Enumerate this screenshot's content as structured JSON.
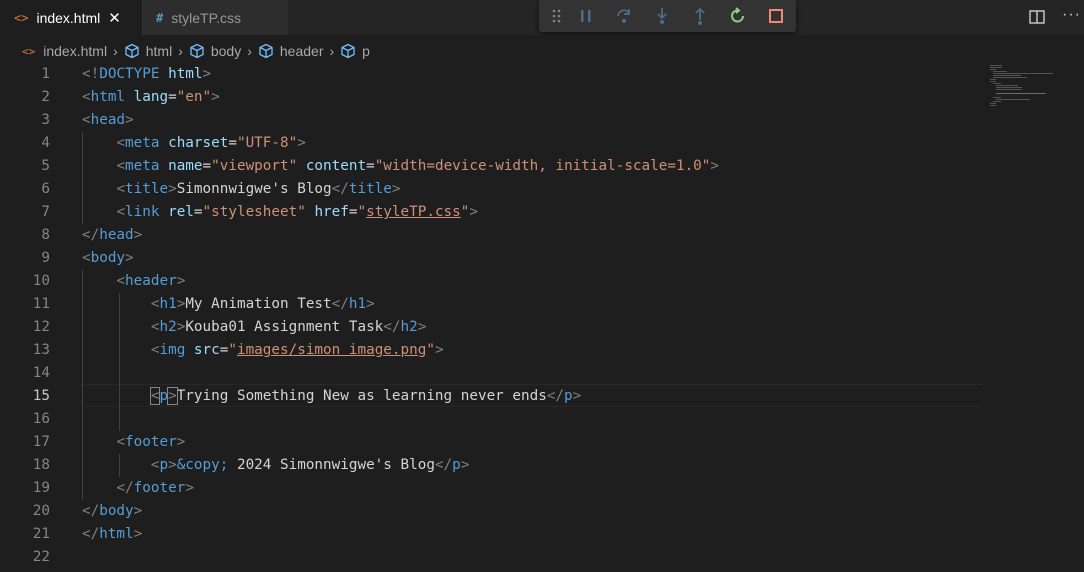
{
  "tabs": [
    {
      "label": "index.html",
      "icon": "html-file-icon",
      "active": true
    },
    {
      "label": "styleTP.css",
      "icon": "css-file-icon",
      "active": false
    }
  ],
  "debug_toolbar": {
    "buttons": [
      "drag-handle",
      "pause",
      "step-over",
      "step-into",
      "step-out",
      "restart",
      "stop"
    ],
    "colors": {
      "restart": "#89d185",
      "stop": "#f48771",
      "default": "#75beff"
    }
  },
  "breadcrumb": [
    "index.html",
    "html",
    "body",
    "header",
    "p"
  ],
  "editor": {
    "lines": [
      {
        "n": "1"
      },
      {
        "n": "2"
      },
      {
        "n": "3"
      },
      {
        "n": "4"
      },
      {
        "n": "5"
      },
      {
        "n": "6"
      },
      {
        "n": "7"
      },
      {
        "n": "8"
      },
      {
        "n": "9"
      },
      {
        "n": "10"
      },
      {
        "n": "11"
      },
      {
        "n": "12"
      },
      {
        "n": "13"
      },
      {
        "n": "14"
      },
      {
        "n": "15"
      },
      {
        "n": "16"
      },
      {
        "n": "17"
      },
      {
        "n": "18"
      },
      {
        "n": "19"
      },
      {
        "n": "20"
      },
      {
        "n": "21"
      },
      {
        "n": "22"
      }
    ],
    "text": {
      "doctype": "html",
      "lang": "\"en\"",
      "charset": "\"UTF-8\"",
      "viewport_name": "\"viewport\"",
      "viewport_content": "\"width=device-width, initial-scale=1.0\"",
      "title": "Simonnwigwe's Blog",
      "rel": "\"stylesheet\"",
      "href": "styleTP.css",
      "h1": "My Animation Test",
      "h2": "Kouba01 Assignment Task",
      "img_src": "images/simon image.png",
      "p": "Trying Something New as learning never ends",
      "footer_entity": "&copy;",
      "footer_text": " 2024 Simonnwigwe's Blog"
    },
    "current_line": "15"
  }
}
